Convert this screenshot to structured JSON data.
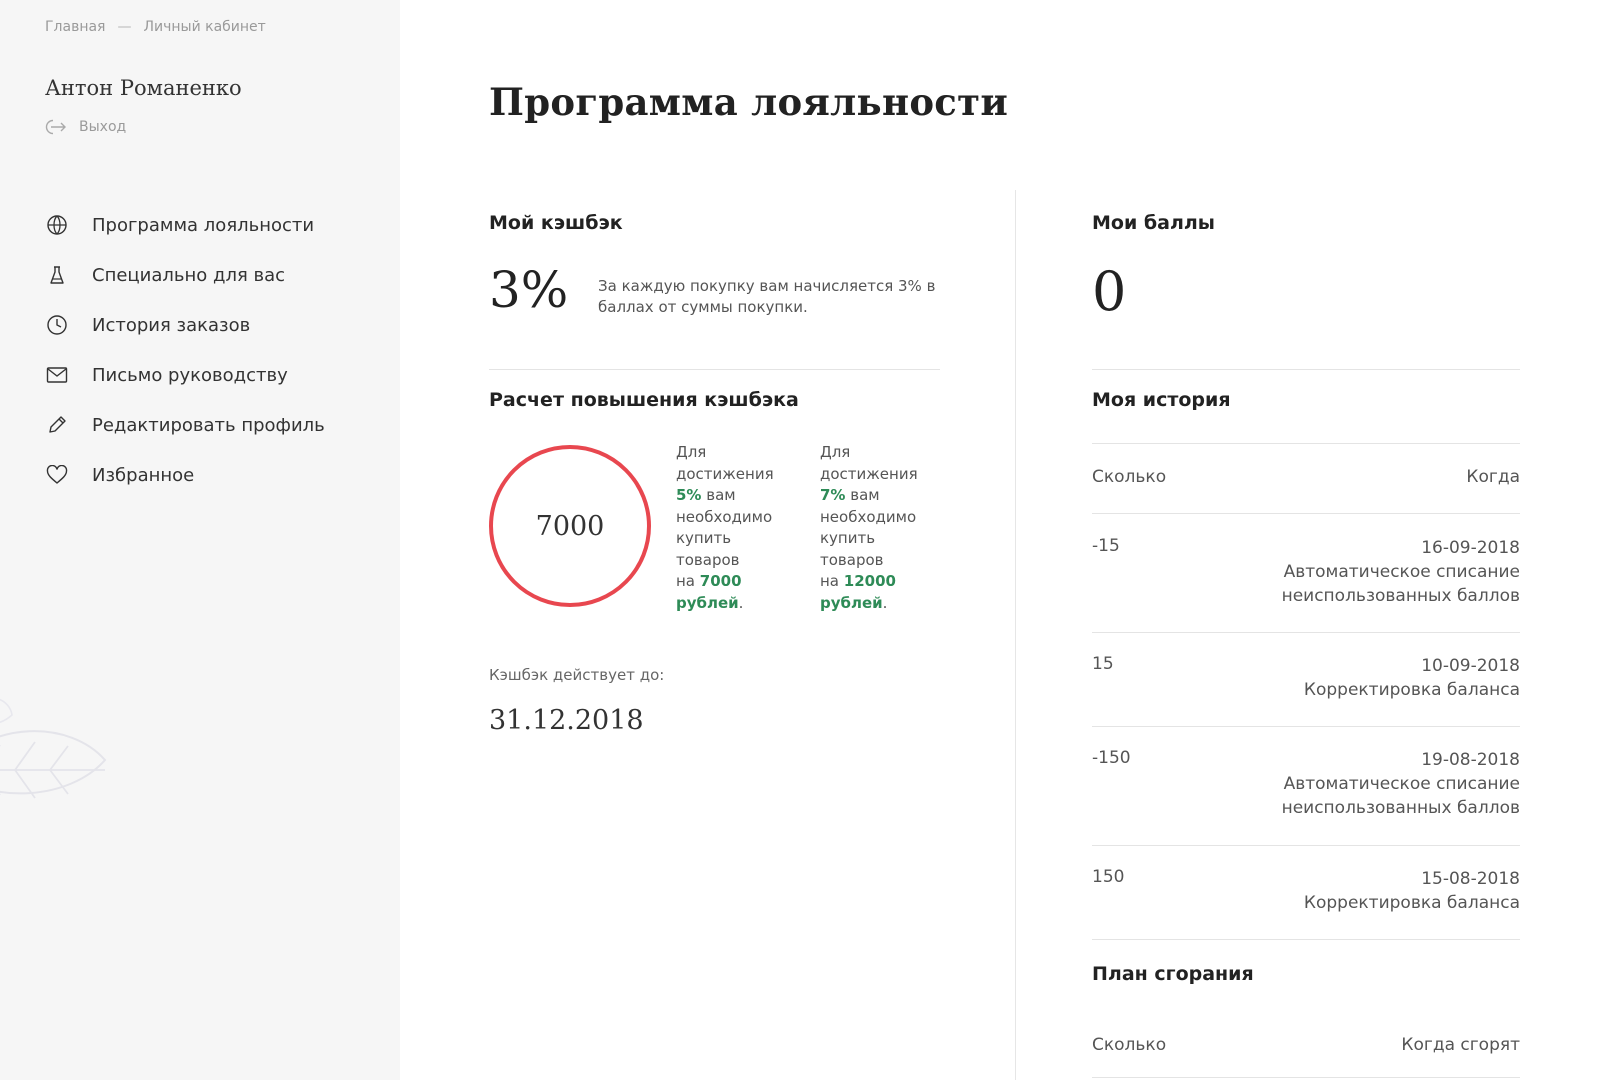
{
  "breadcrumb": {
    "home": "Главная",
    "separator": "—",
    "current": "Личный кабинет"
  },
  "user": {
    "name": "Антон Романенко",
    "logout_label": "Выход",
    "logout_icon": "logout-icon"
  },
  "nav": [
    {
      "label": "Программа лояльности",
      "icon": "loyalty-icon"
    },
    {
      "label": "Специально для вас",
      "icon": "gift-icon"
    },
    {
      "label": "История заказов",
      "icon": "clock-icon"
    },
    {
      "label": "Письмо руководству",
      "icon": "envelope-icon"
    },
    {
      "label": "Редактировать профиль",
      "icon": "pencil-icon"
    },
    {
      "label": "Избранное",
      "icon": "heart-icon"
    }
  ],
  "page": {
    "title": "Программа лояльности"
  },
  "cashback": {
    "title": "Мой кэшбэк",
    "value": "3%",
    "description": "За каждую покупку вам начисляется 3% в баллах от суммы покупки.",
    "calc_title": "Расчет повышения кэшбэка",
    "ring_value": "7000",
    "ring_color": "#e8474f",
    "tiers": [
      {
        "line1": "Для",
        "line2": "достижения",
        "percent": "5%",
        "word_you": " вам",
        "line4": "необходимо",
        "line5": "купить",
        "line6": "товаров",
        "prefix_on": "на ",
        "amount": "7000",
        "currency": "рублей",
        "period": "."
      },
      {
        "line1": "Для",
        "line2": "достижения",
        "percent": "7%",
        "word_you": " вам",
        "line4": "необходимо",
        "line5": "купить",
        "line6": "товаров",
        "prefix_on": "на ",
        "amount": "12000",
        "currency": "рублей",
        "period": "."
      }
    ],
    "valid_label": "Кэшбэк действует до:",
    "valid_date": "31.12.2018"
  },
  "points": {
    "title": "Мои баллы",
    "value": "0",
    "history_title": "Моя история",
    "col_amount": "Сколько",
    "col_when": "Когда",
    "history": [
      {
        "amount": "-15",
        "date": "16-09-2018",
        "desc1": "Автоматическое списание",
        "desc2": "неиспользованных баллов"
      },
      {
        "amount": "15",
        "date": "10-09-2018",
        "desc1": "Корректировка баланса",
        "desc2": ""
      },
      {
        "amount": "-150",
        "date": "19-08-2018",
        "desc1": "Автоматическое списание",
        "desc2": "неиспользованных баллов"
      },
      {
        "amount": "150",
        "date": "15-08-2018",
        "desc1": "Корректировка баланса",
        "desc2": ""
      }
    ],
    "burn_title": "План сгорания",
    "burn_col_amount": "Сколько",
    "burn_col_when": "Когда сгорят"
  },
  "colors": {
    "accent_green": "#2e8b57",
    "ring_red": "#e8474f",
    "sidebar_bg": "#f6f6f6"
  }
}
